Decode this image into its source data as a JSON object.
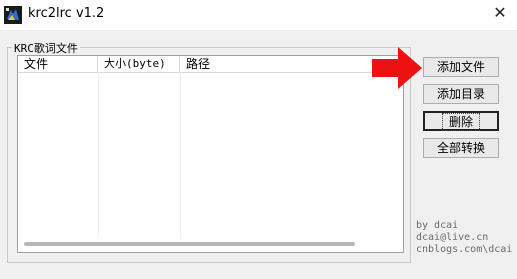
{
  "window": {
    "title": "krc2lrc v1.2",
    "close": "✕"
  },
  "group": {
    "title": "KRC歌词文件"
  },
  "list": {
    "columns": [
      "文件",
      "大小(byte)",
      "路径"
    ]
  },
  "buttons": {
    "add_file": "添加文件",
    "add_dir": "添加目录",
    "delete": "删除",
    "convert_all": "全部转换"
  },
  "credits": [
    "by dcai",
    "dcai@live.cn",
    "cnblogs.com\\dcai"
  ],
  "colors": {
    "arrow": "#ee1111",
    "client_bg": "#f0f0f0"
  },
  "icons": {
    "app": "app-icon",
    "annotation": "red-arrow-icon"
  }
}
